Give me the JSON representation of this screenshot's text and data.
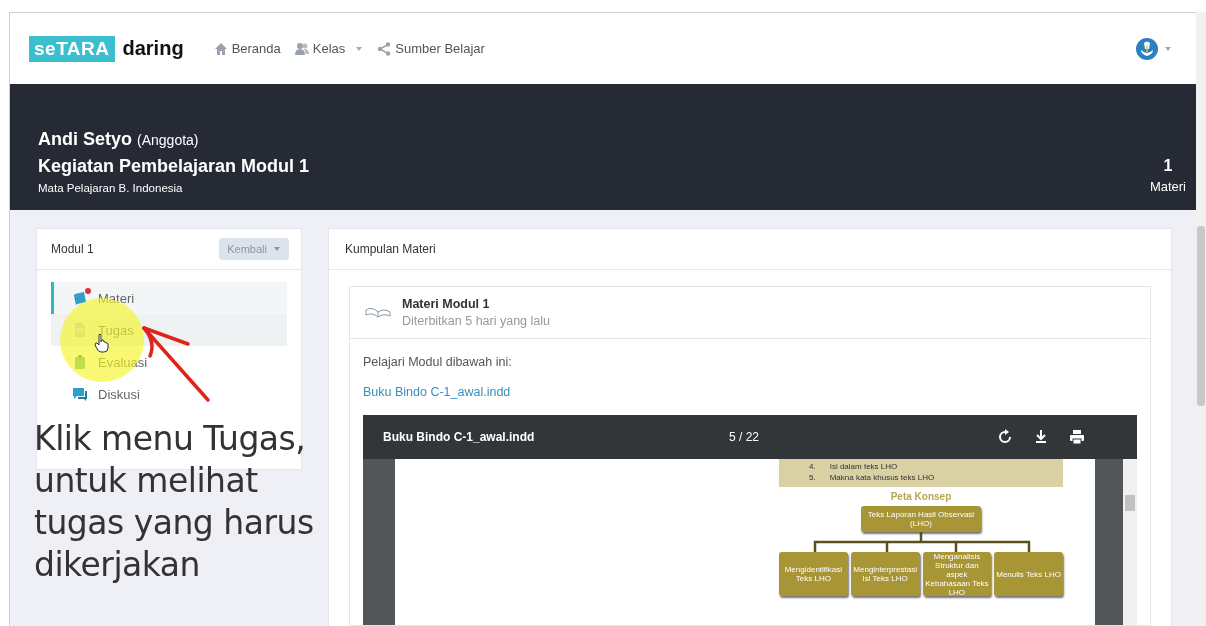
{
  "navbar": {
    "logo_box": "seTARA",
    "logo_text": "daring",
    "links": [
      {
        "label": "Beranda",
        "kind": "home",
        "dropdown": false
      },
      {
        "label": "Kelas",
        "kind": "group",
        "dropdown": true
      },
      {
        "label": "Sumber Belajar",
        "kind": "share",
        "dropdown": false
      }
    ],
    "avatar_dropdown": true
  },
  "header": {
    "user_name": "Andi Setyo",
    "role": "(Anggota)",
    "title": "Kegiatan Pembelajaran Modul 1",
    "subtitle": "Mata Pelajaran B. Indonesia",
    "count": "1",
    "count_label": "Materi"
  },
  "sidebar": {
    "title": "Modul 1",
    "back_button": "Kembali",
    "items": [
      {
        "label": "Materi",
        "kind": "materi",
        "selected": true,
        "hovered": false,
        "badge": true
      },
      {
        "label": "Tugas",
        "kind": "tugas",
        "selected": false,
        "hovered": true,
        "badge": false
      },
      {
        "label": "Evaluasi",
        "kind": "evaluasi",
        "selected": false,
        "hovered": false,
        "badge": false
      },
      {
        "label": "Diskusi",
        "kind": "diskusi",
        "selected": false,
        "hovered": false,
        "badge": false
      }
    ]
  },
  "content": {
    "title": "Kumpulan Materi",
    "card": {
      "title": "Materi Modul 1",
      "meta": "Diterbitkan 5 hari yang lalu",
      "intro": "Pelajari Modul dibawah ini:",
      "link": "Buku Bindo C-1_awal.indd",
      "viewer": {
        "filename": "Buku Bindo C-1_awal.indd",
        "pages": "5 / 22",
        "document": {
          "list": [
            {
              "number": "4.",
              "text": "Isi dalam teks LHO"
            },
            {
              "number": "5.",
              "text": "Makna kata khusus teks LHO"
            }
          ],
          "heading": "Peta Konsep",
          "root": "Teks Laporan Hasil Observasi (LHO)",
          "branches": [
            "Mengidentifikasi Teks LHO",
            "Menginterprestasi Isi Teks LHO",
            "Menganalisis Struktur dan aspek Kebahasaan Teks LHO",
            "Menulis Teks LHO"
          ]
        }
      }
    }
  },
  "annotation": {
    "caption_lines": [
      "Klik menu Tugas,",
      "untuk melihat",
      "tugas yang harus",
      "dikerjakan"
    ]
  }
}
